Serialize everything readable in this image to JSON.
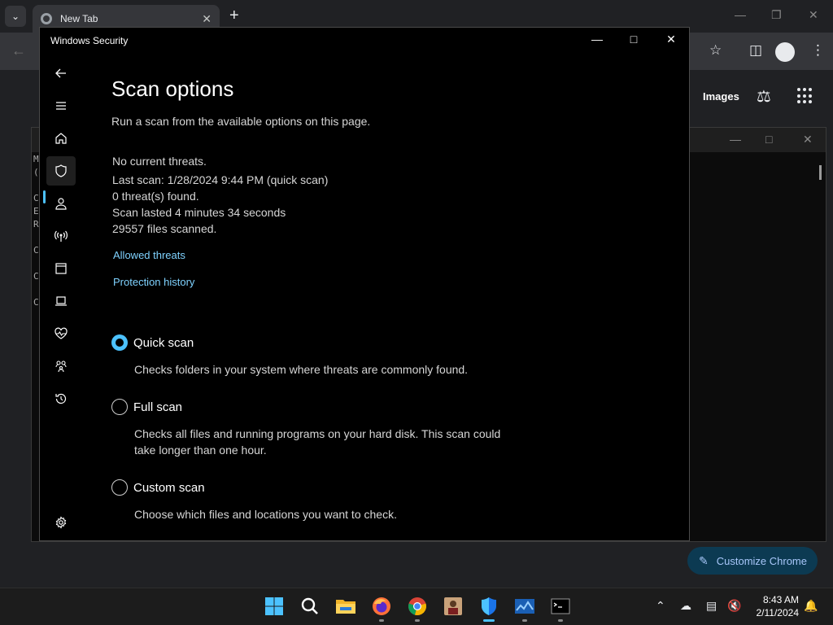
{
  "chrome": {
    "tab_title": "New Tab",
    "new_tab_symbol": "+",
    "images_link": "Images",
    "customize_label": "Customize Chrome",
    "accent": "#a8c7fa"
  },
  "terminal": {
    "lines": [
      "M",
      "(",
      "C",
      "E",
      "R",
      "C",
      "C",
      "C"
    ]
  },
  "window": {
    "title": "Windows Security",
    "accent": "#4cc2ff"
  },
  "nav": {
    "items": [
      {
        "icon": "back-arrow-icon"
      },
      {
        "icon": "hamburger-menu-icon"
      },
      {
        "icon": "home-icon"
      },
      {
        "icon": "shield-icon",
        "active": true
      },
      {
        "icon": "person-icon"
      },
      {
        "icon": "wireless-icon"
      },
      {
        "icon": "app-browser-icon"
      },
      {
        "icon": "laptop-icon"
      },
      {
        "icon": "heart-pulse-icon"
      },
      {
        "icon": "family-icon"
      },
      {
        "icon": "history-icon"
      },
      {
        "icon": "settings-gear-icon"
      }
    ]
  },
  "page": {
    "title": "Scan options",
    "subtitle": "Run a scan from the available options on this page.",
    "status": {
      "threats": "No current threats.",
      "last_scan": "Last scan: 1/28/2024 9:44 PM (quick scan)",
      "found": "0 threat(s) found.",
      "duration": "Scan lasted 4 minutes 34 seconds",
      "files": "29557 files scanned."
    },
    "links": {
      "allowed": "Allowed threats",
      "history": "Protection history"
    },
    "scan_options": [
      {
        "label": "Quick scan",
        "description": "Checks folders in your system where threats are commonly found.",
        "selected": true
      },
      {
        "label": "Full scan",
        "description": "Checks all files and running programs on your hard disk. This scan could take longer than one hour.",
        "selected": false
      },
      {
        "label": "Custom scan",
        "description": "Choose which files and locations you want to check.",
        "selected": false
      }
    ]
  },
  "taskbar": {
    "apps": [
      "start-icon",
      "search-icon",
      "file-explorer-icon",
      "firefox-icon",
      "chrome-icon",
      "app-icon",
      "windows-security-icon",
      "task-manager-icon",
      "terminal-icon"
    ],
    "time": "8:43 AM",
    "date": "2/11/2024"
  }
}
